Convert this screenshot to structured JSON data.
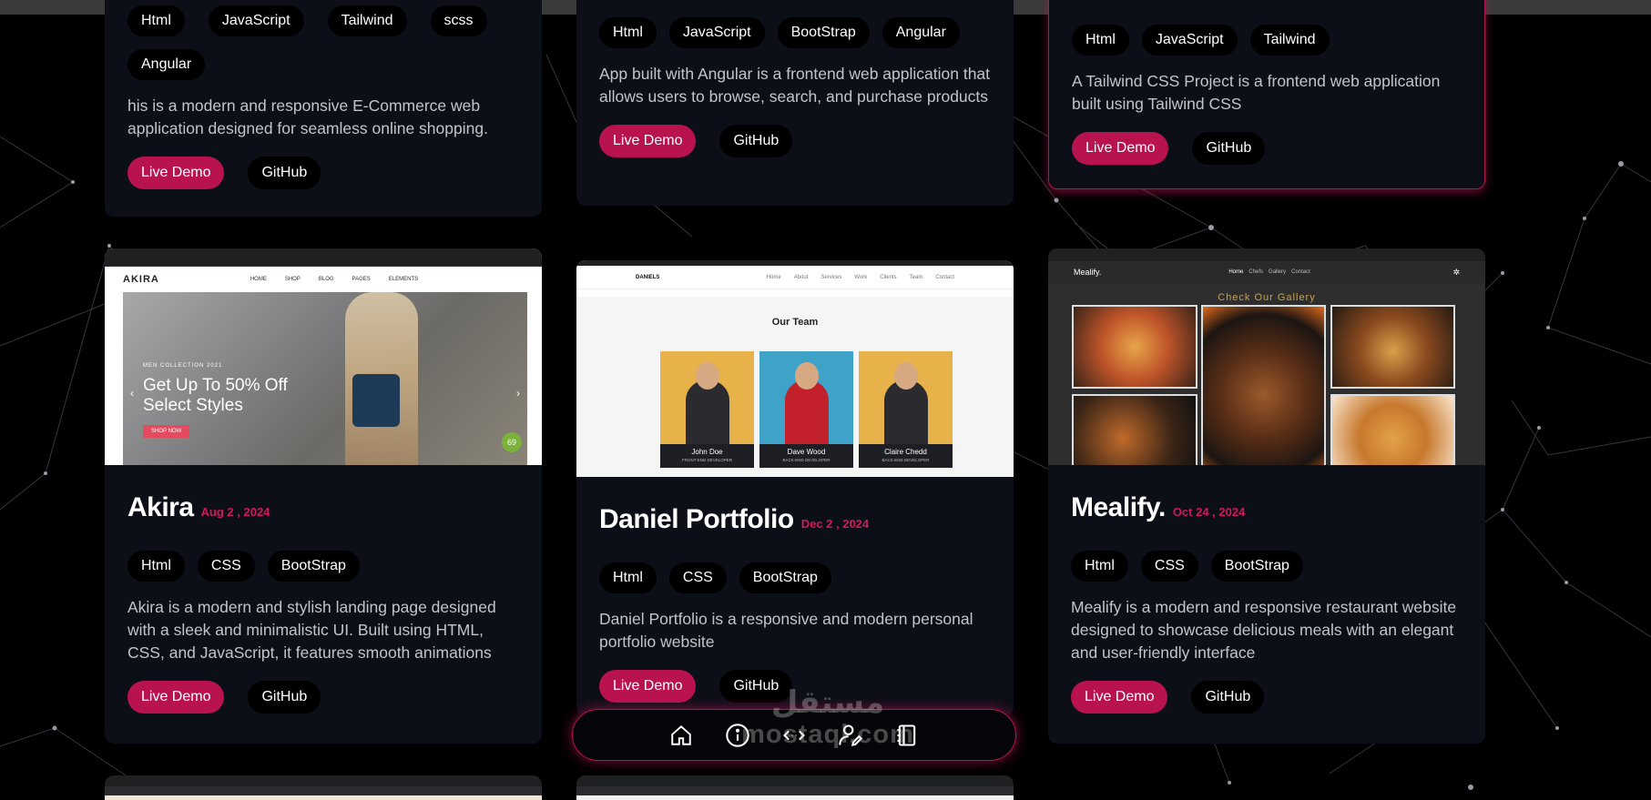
{
  "row1": [
    {
      "tags": [
        "Html",
        "JavaScript",
        "Tailwind",
        "scss",
        "Angular"
      ],
      "description": "his is a modern and responsive E-Commerce web application designed for seamless online shopping.",
      "demo_label": "Live Demo",
      "github_label": "GitHub"
    },
    {
      "tags": [
        "Html",
        "JavaScript",
        "BootStrap",
        "Angular"
      ],
      "description": "App built with Angular is a frontend web application that allows users to browse, search, and purchase products",
      "demo_label": "Live Demo",
      "github_label": "GitHub"
    },
    {
      "tags": [
        "Html",
        "JavaScript",
        "Tailwind"
      ],
      "description": "A Tailwind CSS Project is a frontend web application built using Tailwind CSS",
      "demo_label": "Live Demo",
      "github_label": "GitHub"
    }
  ],
  "row2": [
    {
      "title": "Akira",
      "date": "Aug 2 , 2024",
      "tags": [
        "Html",
        "CSS",
        "BootStrap"
      ],
      "description": "Akira is a modern and stylish landing page designed with a sleek and minimalistic UI. Built using HTML, CSS, and JavaScript, it features smooth animations",
      "demo_label": "Live Demo",
      "github_label": "GitHub",
      "screenshot": {
        "logo": "AKIRA",
        "nav": [
          "HOME",
          "SHOP",
          "BLOG",
          "PAGES",
          "ELEMENTS"
        ],
        "sub": "MEN COLLECTION 2021",
        "headline": "Get Up To 50% Off Select Styles",
        "cta": "SHOP NOW",
        "badge": "69"
      }
    },
    {
      "title": "Daniel Portfolio",
      "date": "Dec 2 , 2024",
      "tags": [
        "Html",
        "CSS",
        "BootStrap"
      ],
      "description": "Daniel Portfolio is a responsive and modern personal portfolio website",
      "demo_label": "Live Demo",
      "github_label": "GitHub",
      "screenshot": {
        "logo": "DANIELS",
        "nav": [
          "Home",
          "About",
          "Services",
          "Work",
          "Clients",
          "Team",
          "Contact"
        ],
        "heading": "Our Team",
        "team": [
          {
            "name": "John Doe",
            "role": "FRONT-END DEVELOPER"
          },
          {
            "name": "Dave Wood",
            "role": "BACK-END DEVELOPER"
          },
          {
            "name": "Claire Chedd",
            "role": "BACK-END DEVELOPER"
          }
        ]
      }
    },
    {
      "title": "Mealify.",
      "date": "Oct 24 , 2024",
      "tags": [
        "Html",
        "CSS",
        "BootStrap"
      ],
      "description": "Mealify is a modern and responsive restaurant website designed to showcase delicious meals with an elegant and user-friendly interface",
      "demo_label": "Live Demo",
      "github_label": "GitHub",
      "screenshot": {
        "logo": "Mealify.",
        "nav": [
          "Home",
          "Chefs",
          "Gallery",
          "Contact"
        ],
        "heading": "Check Our Gallery"
      }
    }
  ],
  "bottom_nav": [
    "home-icon",
    "info-icon",
    "code-icon",
    "user-edit-icon",
    "notebook-icon"
  ],
  "watermark": {
    "arabic": "مستقل",
    "latin": "mostaql.com"
  },
  "colors": {
    "accent": "#b8124f",
    "date": "#d11a5a",
    "card": "#0c0e18",
    "background": "#000000"
  }
}
